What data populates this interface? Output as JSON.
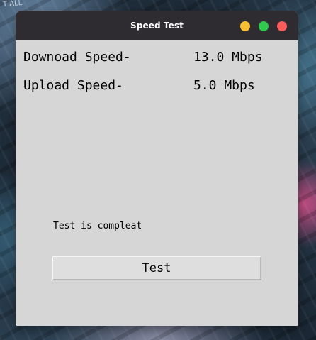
{
  "window": {
    "title": "Speed Test"
  },
  "speeds": {
    "download_label": "Downoad Speed-",
    "download_value": "13.0 Mbps",
    "upload_label": "Upload Speed-",
    "upload_value": "5.0 Mbps"
  },
  "status": {
    "text": "Test is compleat"
  },
  "buttons": {
    "test_label": "Test"
  },
  "wallpaper": {
    "text": "T ALL"
  },
  "colors": {
    "titlebar": "#2e2b31",
    "window_bg": "#d6d6d6",
    "minimize": "#f6be33",
    "maximize": "#30c84d",
    "close": "#fa5b5b"
  }
}
